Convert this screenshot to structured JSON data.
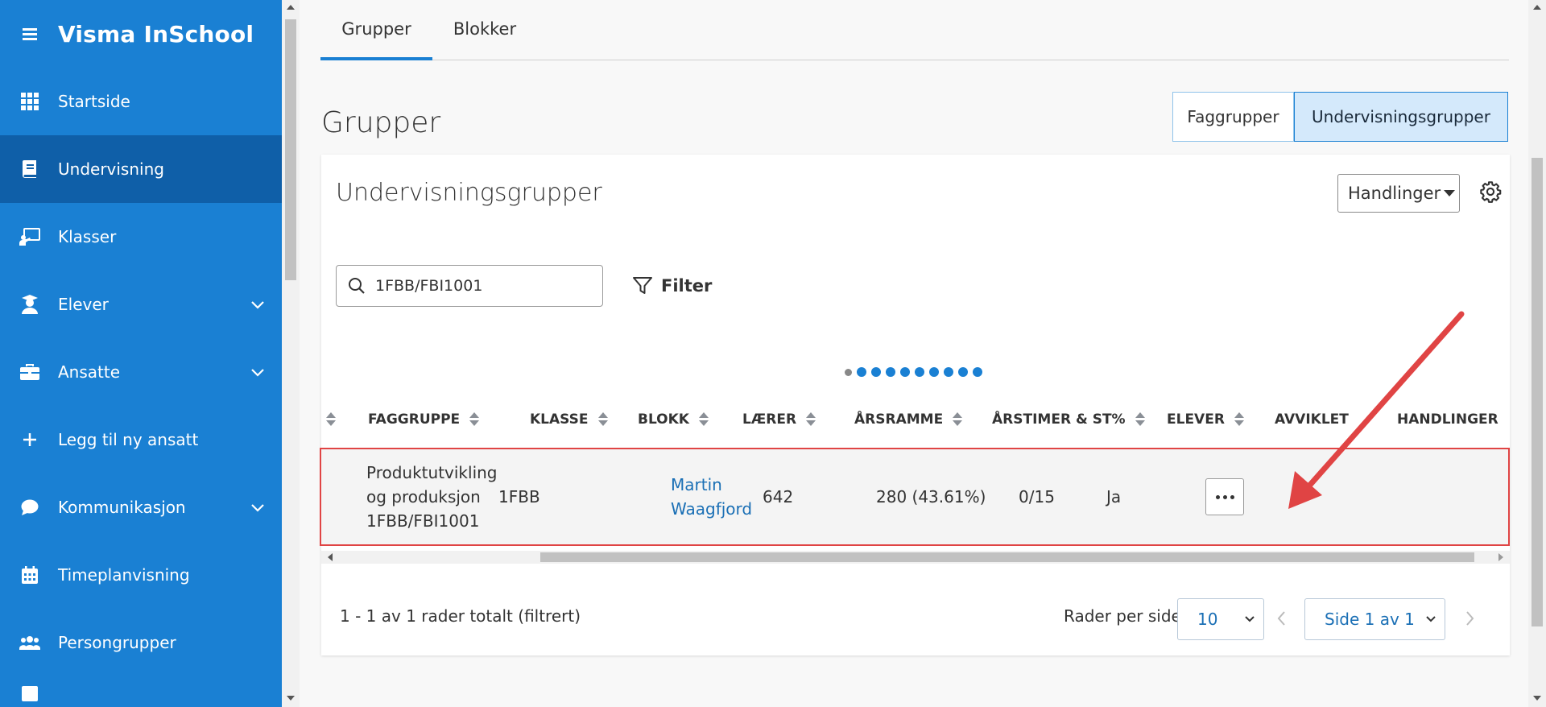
{
  "app": {
    "title": "Visma InSchool"
  },
  "sidebar": {
    "items": [
      {
        "label": "Startside",
        "icon": "grid-icon",
        "active": false,
        "expandable": false
      },
      {
        "label": "Undervisning",
        "icon": "book-icon",
        "active": true,
        "expandable": false
      },
      {
        "label": "Klasser",
        "icon": "classroom-icon",
        "active": false,
        "expandable": false
      },
      {
        "label": "Elever",
        "icon": "student-icon",
        "active": false,
        "expandable": true
      },
      {
        "label": "Ansatte",
        "icon": "briefcase-icon",
        "active": false,
        "expandable": true
      },
      {
        "label": "Legg til ny ansatt",
        "icon": "plus-icon",
        "active": false,
        "expandable": false
      },
      {
        "label": "Kommunikasjon",
        "icon": "chat-icon",
        "active": false,
        "expandable": true
      },
      {
        "label": "Timeplanvisning",
        "icon": "calendar-icon",
        "active": false,
        "expandable": false
      },
      {
        "label": "Persongrupper",
        "icon": "people-icon",
        "active": false,
        "expandable": false
      }
    ]
  },
  "tabs": [
    {
      "label": "Grupper",
      "active": true
    },
    {
      "label": "Blokker",
      "active": false
    }
  ],
  "page_title": "Grupper",
  "segment": {
    "faggrupper": "Faggrupper",
    "undervisningsgrupper": "Undervisningsgrupper",
    "selected": "Undervisningsgrupper"
  },
  "card": {
    "title": "Undervisningsgrupper",
    "actions_label": "Handlinger"
  },
  "search": {
    "value": "1FBB/FBI1001"
  },
  "filter_label": "Filter",
  "table": {
    "headers": {
      "faggruppe": "FAGGRUPPE",
      "klasse": "KLASSE",
      "blokk": "BLOKK",
      "laerer": "LÆRER",
      "arsramme": "ÅRSRAMME",
      "arstimer": "ÅRSTIMER & ST%",
      "elever": "ELEVER",
      "avviklet": "AVVIKLET",
      "handlinger": "HANDLINGER"
    },
    "rows": [
      {
        "faggruppe_line1": "Produktutvikling",
        "faggruppe_line2": "og produksjon",
        "faggruppe_line3": "1FBB/FBI1001",
        "klasse": "1FBB",
        "blokk": "",
        "laerer_line1": "Martin",
        "laerer_line2": "Waagfjord",
        "arsramme": "642",
        "arstimer": "280 (43.61%)",
        "elever": "0/15",
        "avviklet": "Ja"
      }
    ]
  },
  "footer": {
    "rows_total": "1 - 1 av 1 rader totalt (filtrert)",
    "rows_per_page_label": "Rader per side",
    "rows_per_page_value": "10",
    "page_value": "Side 1 av 1"
  },
  "colors": {
    "sidebar": "#1a80d3",
    "sidebar_active": "#0f5fa8",
    "link": "#1a6fb5",
    "annotation": "#e04444"
  }
}
